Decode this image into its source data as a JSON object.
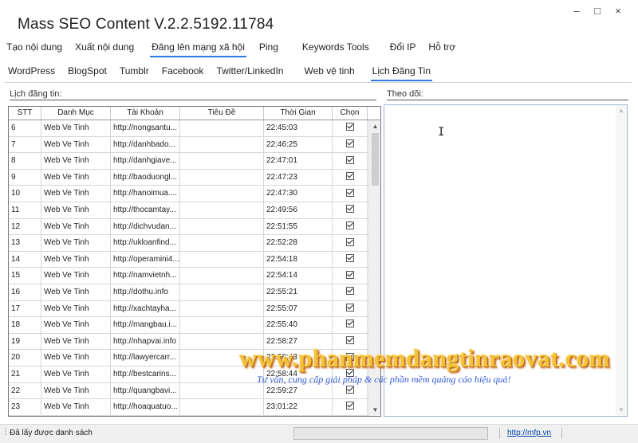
{
  "window": {
    "title": "Mass SEO Content V.2.2.5192.11784",
    "controls": [
      "–",
      "□",
      "×"
    ]
  },
  "main_tabs": [
    {
      "label": "Tạo nội dung",
      "active": false
    },
    {
      "label": "Xuất nội dung",
      "active": false
    },
    {
      "label": "Đăng lên mạng xã hội",
      "active": true
    },
    {
      "label": "Ping",
      "active": false
    },
    {
      "label": "Keywords Tools",
      "active": false
    },
    {
      "label": "Đổi IP",
      "active": false
    },
    {
      "label": "Hỗ trợ",
      "active": false
    }
  ],
  "sub_tabs": [
    {
      "label": "WordPress",
      "active": false
    },
    {
      "label": "BlogSpot",
      "active": false
    },
    {
      "label": "Tumblr",
      "active": false
    },
    {
      "label": "Facebook",
      "active": false
    },
    {
      "label": "Twitter/LinkedIn",
      "active": false
    },
    {
      "label": "Web vệ tinh",
      "active": false
    },
    {
      "label": "Lịch Đăng Tin",
      "active": true
    }
  ],
  "schedule": {
    "label": "Lịch đăng tin:",
    "columns": {
      "stt": "STT",
      "danh_muc": "Danh Mục",
      "tai_khoan": "Tài Khoản",
      "tieu_de": "Tiêu Đề",
      "thoi_gian": "Thời Gian",
      "chon": "Chọn"
    },
    "rows": [
      {
        "stt": "6",
        "danh_muc": "Web Ve Tinh",
        "tai_khoan": "http://nongsantu...",
        "tieu_de": "",
        "thoi_gian": "22:45:03",
        "chon": true
      },
      {
        "stt": "7",
        "danh_muc": "Web Ve Tinh",
        "tai_khoan": "http://danhbado...",
        "tieu_de": "",
        "thoi_gian": "22:46:25",
        "chon": true
      },
      {
        "stt": "8",
        "danh_muc": "Web Ve Tinh",
        "tai_khoan": "http://danhgiave...",
        "tieu_de": "",
        "thoi_gian": "22:47:01",
        "chon": true
      },
      {
        "stt": "9",
        "danh_muc": "Web Ve Tinh",
        "tai_khoan": "http://baoduongl...",
        "tieu_de": "",
        "thoi_gian": "22:47:23",
        "chon": true
      },
      {
        "stt": "10",
        "danh_muc": "Web Ve Tinh",
        "tai_khoan": "http://hanoimua....",
        "tieu_de": "",
        "thoi_gian": "22:47:30",
        "chon": true
      },
      {
        "stt": "11",
        "danh_muc": "Web Ve Tinh",
        "tai_khoan": "http://thocamtay...",
        "tieu_de": "",
        "thoi_gian": "22:49:56",
        "chon": true
      },
      {
        "stt": "12",
        "danh_muc": "Web Ve Tinh",
        "tai_khoan": "http://dichvudan...",
        "tieu_de": "",
        "thoi_gian": "22:51:55",
        "chon": true
      },
      {
        "stt": "13",
        "danh_muc": "Web Ve Tinh",
        "tai_khoan": "http://ukloanfind...",
        "tieu_de": "",
        "thoi_gian": "22:52:28",
        "chon": true
      },
      {
        "stt": "14",
        "danh_muc": "Web Ve Tinh",
        "tai_khoan": "http://operamini4...",
        "tieu_de": "",
        "thoi_gian": "22:54:18",
        "chon": true
      },
      {
        "stt": "15",
        "danh_muc": "Web Ve Tinh",
        "tai_khoan": "http://namvietnh...",
        "tieu_de": "",
        "thoi_gian": "22:54:14",
        "chon": true
      },
      {
        "stt": "16",
        "danh_muc": "Web Ve Tinh",
        "tai_khoan": "http://dothu.info",
        "tieu_de": "",
        "thoi_gian": "22:55:21",
        "chon": true
      },
      {
        "stt": "17",
        "danh_muc": "Web Ve Tinh",
        "tai_khoan": "http://xachtayha...",
        "tieu_de": "",
        "thoi_gian": "22:55:07",
        "chon": true
      },
      {
        "stt": "18",
        "danh_muc": "Web Ve Tinh",
        "tai_khoan": "http://mangbau.i...",
        "tieu_de": "",
        "thoi_gian": "22:55:40",
        "chon": true
      },
      {
        "stt": "19",
        "danh_muc": "Web Ve Tinh",
        "tai_khoan": "http://nhapvai.info",
        "tieu_de": "",
        "thoi_gian": "22:58:27",
        "chon": true
      },
      {
        "stt": "20",
        "danh_muc": "Web Ve Tinh",
        "tai_khoan": "http://lawyercarr...",
        "tieu_de": "",
        "thoi_gian": "22:58:43",
        "chon": true
      },
      {
        "stt": "21",
        "danh_muc": "Web Ve Tinh",
        "tai_khoan": "http://bestcarins...",
        "tieu_de": "",
        "thoi_gian": "22:58:44",
        "chon": true
      },
      {
        "stt": "22",
        "danh_muc": "Web Ve Tinh",
        "tai_khoan": "http://quangbavi...",
        "tieu_de": "",
        "thoi_gian": "22:59:27",
        "chon": true
      },
      {
        "stt": "23",
        "danh_muc": "Web Ve Tinh",
        "tai_khoan": "http://hoaquatuo...",
        "tieu_de": "",
        "thoi_gian": "23:01:22",
        "chon": true
      }
    ]
  },
  "monitor": {
    "label": "Theo dõi:",
    "content": ""
  },
  "status_bar": {
    "text": "Đã lấy được danh sách",
    "link": "http://mfp.vn"
  },
  "watermark": {
    "main": "www.phanmemdangtinraovat.com",
    "sub": "Tư vấn, cung cấp giải pháp & các phần mềm quảng cáo hiệu quả!"
  },
  "colors": {
    "tab_underline": "#2c7be5",
    "link": "#0645ad",
    "watermark_main": "#f3c13a",
    "watermark_sub": "#2f58d8"
  }
}
